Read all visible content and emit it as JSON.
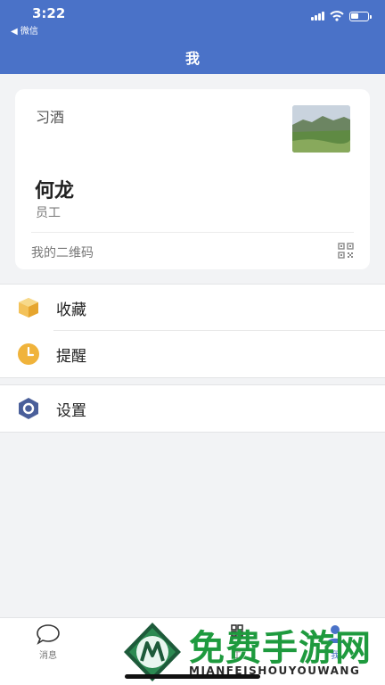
{
  "status_bar": {
    "time": "3:22",
    "back_label": "◀ 微信"
  },
  "nav": {
    "title": "我"
  },
  "profile": {
    "org_name": "习酒",
    "user_name": "何龙",
    "role": "员工",
    "qr_label": "我的二维码"
  },
  "menu": {
    "group1": [
      {
        "label": "收藏",
        "icon": "box-icon",
        "color": "#f0b33b"
      },
      {
        "label": "提醒",
        "icon": "clock-icon",
        "color": "#f0b33b"
      }
    ],
    "group2": [
      {
        "label": "设置",
        "icon": "hexagon-settings-icon",
        "color": "#4a5f9a"
      }
    ]
  },
  "tabbar": {
    "messages_label": "消息",
    "work_label": "工",
    "me_label": "我"
  },
  "watermark": {
    "text": "免费手游网",
    "sub": "MIANFEISHOUYOUWANG"
  },
  "colors": {
    "header": "#4a72c8",
    "background": "#f2f3f5",
    "watermark_green": "#1e9a3e"
  }
}
